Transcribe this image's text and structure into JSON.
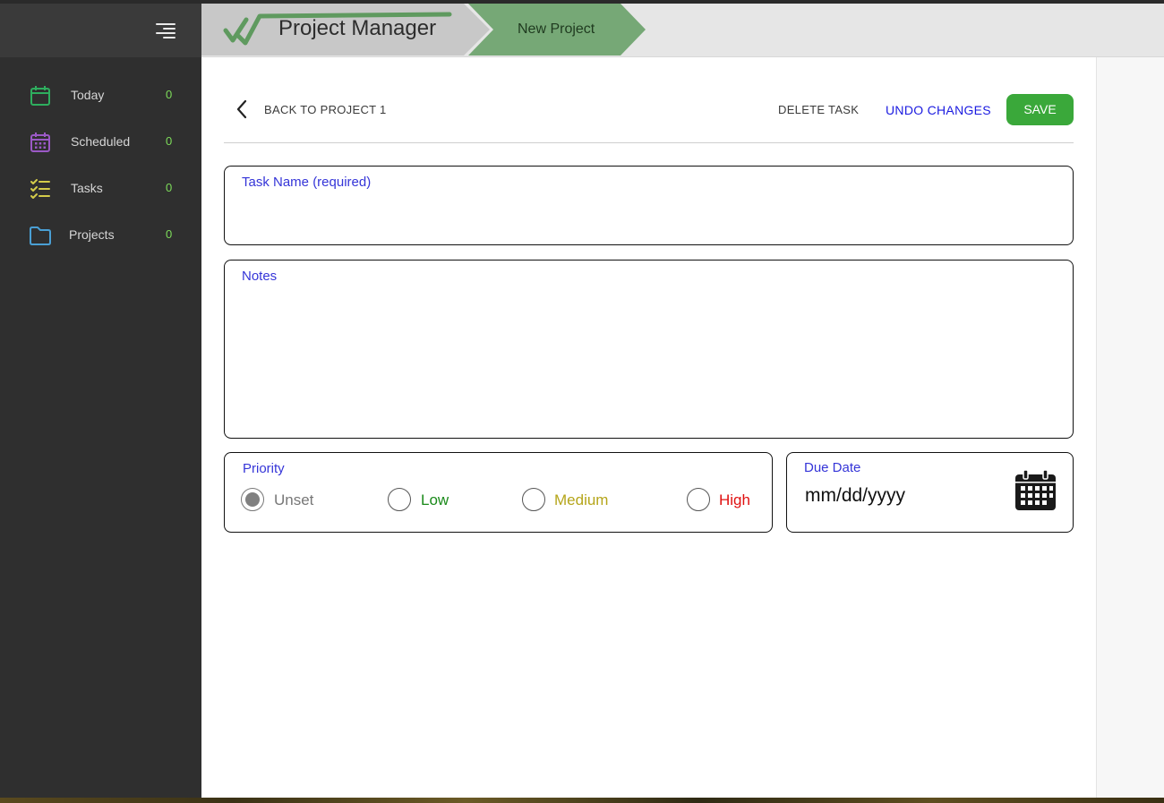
{
  "app": {
    "title": "Project Manager",
    "breadcrumb_current": "New Project"
  },
  "sidebar": {
    "items": [
      {
        "label": "Today",
        "count": "0",
        "icon": "calendar-icon",
        "icon_color": "#2eae5e"
      },
      {
        "label": "Scheduled",
        "count": "0",
        "icon": "calendar-grid-icon",
        "icon_color": "#9b59c6"
      },
      {
        "label": "Tasks",
        "count": "0",
        "icon": "checklist-icon",
        "icon_color": "#d4cc4a"
      },
      {
        "label": "Projects",
        "count": "0",
        "icon": "folder-icon",
        "icon_color": "#4a9fd4"
      }
    ],
    "count_color": "#7ddc5a"
  },
  "toolbar": {
    "back_label": "BACK TO PROJECT 1",
    "delete_label": "DELETE TASK",
    "undo_label": "UNDO CHANGES",
    "save_label": "SAVE"
  },
  "form": {
    "task_name_label": "Task Name (required)",
    "task_name_value": "",
    "notes_label": "Notes",
    "notes_value": "",
    "priority": {
      "label": "Priority",
      "selected": "Unset",
      "options": [
        {
          "label": "Unset",
          "color": "#777777"
        },
        {
          "label": "Low",
          "color": "#1a8a1a"
        },
        {
          "label": "Medium",
          "color": "#b5a51a"
        },
        {
          "label": "High",
          "color": "#e01010"
        }
      ]
    },
    "due_date": {
      "label": "Due Date",
      "placeholder": "mm/dd/yyyy"
    }
  },
  "colors": {
    "accent_green": "#3aa83a",
    "link_blue": "#1a1ae0",
    "breadcrumb_green": "#76a876"
  }
}
